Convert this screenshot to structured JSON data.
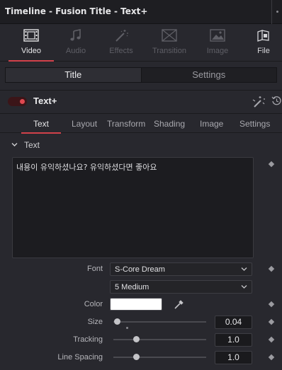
{
  "window": {
    "title": "Timeline - Fusion Title - Text+"
  },
  "categories": [
    {
      "label": "Video",
      "icon": "film-icon",
      "state": "active"
    },
    {
      "label": "Audio",
      "icon": "music-note-icon",
      "state": "disabled"
    },
    {
      "label": "Effects",
      "icon": "magic-wand-icon",
      "state": "disabled"
    },
    {
      "label": "Transition",
      "icon": "transition-icon",
      "state": "disabled"
    },
    {
      "label": "Image",
      "icon": "image-icon",
      "state": "disabled"
    },
    {
      "label": "File",
      "icon": "file-icon",
      "state": "enabled"
    }
  ],
  "segmented": {
    "title": "Title",
    "settings": "Settings",
    "selected": "Title"
  },
  "tool": {
    "name": "Text+",
    "enabled": true,
    "accent": "#d2414a"
  },
  "sub_tabs": [
    "Text",
    "Layout",
    "Transform",
    "Shading",
    "Image",
    "Settings"
  ],
  "section": {
    "label": "Text"
  },
  "text_content": "내용이 유익하셨나요? 유익하셨다면 좋아요",
  "font": {
    "label": "Font",
    "family": "S-Core Dream",
    "style": "5 Medium"
  },
  "color": {
    "label": "Color",
    "value": "#ffffff"
  },
  "size": {
    "label": "Size",
    "value": "0.04",
    "fraction": 0.04
  },
  "tracking": {
    "label": "Tracking",
    "value": "1.0",
    "fraction": 0.25
  },
  "line_spacing": {
    "label": "Line Spacing",
    "value": "1.0",
    "fraction": 0.25
  }
}
